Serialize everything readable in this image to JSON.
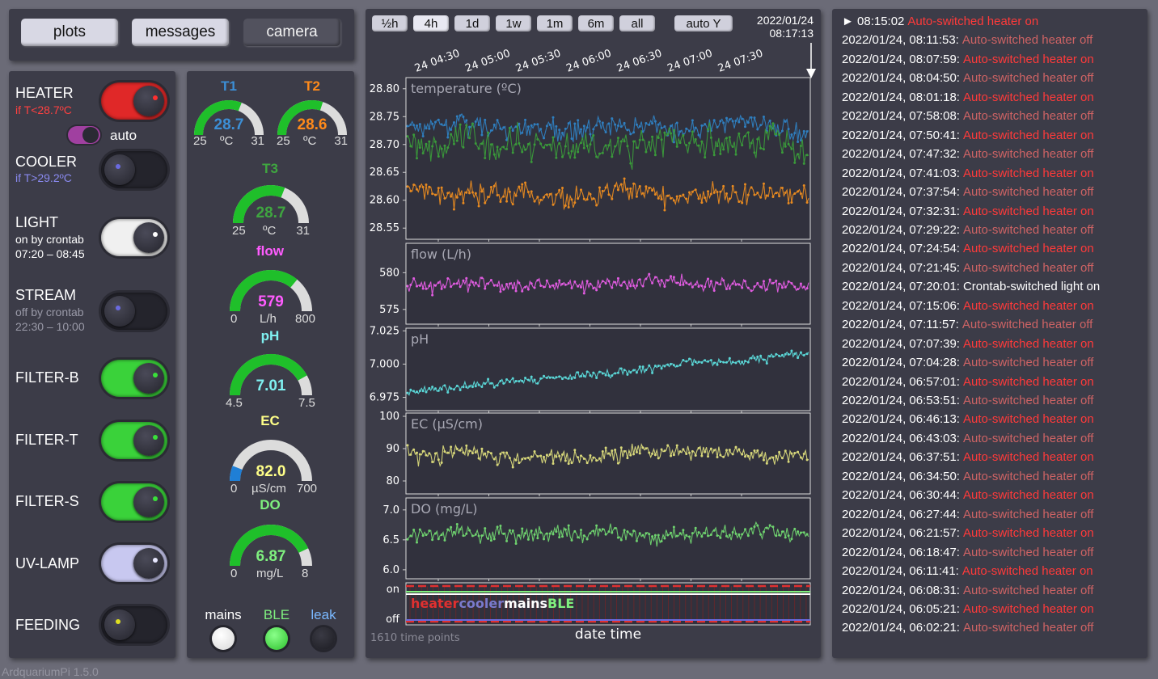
{
  "tabs": [
    {
      "label": "plots"
    },
    {
      "label": "messages"
    },
    {
      "label": "camera"
    }
  ],
  "controls": {
    "heater": {
      "label": "HEATER",
      "sub": "if T<28.7ºC",
      "auto_label": "auto"
    },
    "cooler": {
      "label": "COOLER",
      "sub": "if T>29.2ºC"
    },
    "light": {
      "label": "LIGHT",
      "sub1": "on by crontab",
      "sub2": "07:20 – 08:45"
    },
    "stream": {
      "label": "STREAM",
      "sub1": "off by crontab",
      "sub2": "22:30 – 10:00"
    },
    "filter_b": {
      "label": "FILTER-B"
    },
    "filter_t": {
      "label": "FILTER-T"
    },
    "filter_s": {
      "label": "FILTER-S"
    },
    "uv_lamp": {
      "label": "UV-LAMP"
    },
    "feeding": {
      "label": "FEEDING"
    }
  },
  "gauges": {
    "t1": {
      "title": "T1",
      "value": "28.7",
      "min": "25",
      "max": "31",
      "unit": "ºC",
      "fraction": 0.62,
      "color": "#3c8fd6"
    },
    "t2": {
      "title": "T2",
      "value": "28.6",
      "min": "25",
      "max": "31",
      "unit": "ºC",
      "fraction": 0.6,
      "color": "#ff8a1a"
    },
    "t3": {
      "title": "T3",
      "value": "28.7",
      "min": "25",
      "max": "31",
      "unit": "ºC",
      "fraction": 0.62,
      "color": "#3fa640"
    },
    "flow": {
      "title": "flow",
      "value": "579",
      "min": "0",
      "max": "800",
      "unit": "L/h",
      "fraction": 0.72,
      "color": "#ff5cff"
    },
    "ph": {
      "title": "pH",
      "value": "7.01",
      "min": "4.5",
      "max": "7.5",
      "unit": "",
      "fraction": 0.84,
      "color": "#7ff0f0"
    },
    "ec": {
      "title": "EC",
      "value": "82.0",
      "min": "0",
      "max": "700",
      "unit": "µS/cm",
      "fraction": 0.12,
      "color": "#ffff88"
    },
    "do": {
      "title": "DO",
      "value": "6.87",
      "min": "0",
      "max": "8",
      "unit": "mg/L",
      "fraction": 0.86,
      "color": "#7ff07f"
    }
  },
  "indicators": [
    {
      "label": "mains",
      "color": "#ffffff",
      "led": "#f4f4f4"
    },
    {
      "label": "BLE",
      "color": "#7ff07f",
      "led": "#3fe03f"
    },
    {
      "label": "leak",
      "color": "#7ab8ff",
      "led": "#26262e"
    }
  ],
  "range_buttons": [
    "½h",
    "4h",
    "1d",
    "1w",
    "1m",
    "6m",
    "all"
  ],
  "auto_y": "auto Y",
  "timestamp": {
    "date": "2022/01/24",
    "time": "08:17:13"
  },
  "chart_data": {
    "type": "line",
    "x_ticks": [
      "24 04:30",
      "24 05:00",
      "24 05:30",
      "24 06:00",
      "24 06:30",
      "24 07:00",
      "24 07:30"
    ],
    "xlabel": "date time",
    "points_note": "1610 time points",
    "panels": [
      {
        "title": "temperature (ºC)",
        "ylim": [
          28.53,
          28.82
        ],
        "ticks": [
          "28.80",
          "28.75",
          "28.70",
          "28.65",
          "28.60",
          "28.55"
        ],
        "series": [
          {
            "color": "#2f7fc0",
            "center": 28.73,
            "noise": 0.025
          },
          {
            "color": "#3a9a3a",
            "center": 28.7,
            "noise": 0.04
          },
          {
            "color": "#e88a20",
            "center": 28.61,
            "noise": 0.03
          }
        ]
      },
      {
        "title": "flow (L/h)",
        "ylim": [
          573,
          584
        ],
        "ticks": [
          "580",
          "575"
        ],
        "series": [
          {
            "color": "#e15ce1",
            "center": 578.5,
            "noise": 1.3
          }
        ]
      },
      {
        "title": "pH",
        "ylim": [
          6.965,
          7.027
        ],
        "ticks": [
          "7.025",
          "7.000",
          "6.975"
        ],
        "series": [
          {
            "color": "#5ad6d6",
            "center_start": 6.979,
            "center_end": 7.008,
            "noise": 0.004
          }
        ]
      },
      {
        "title": "EC (µS/cm)",
        "ylim": [
          76,
          101
        ],
        "ticks": [
          "100",
          "90",
          "80"
        ],
        "series": [
          {
            "color": "#d8d87a",
            "center": 88.5,
            "noise": 3.5
          }
        ]
      },
      {
        "title": "DO (mg/L)",
        "ylim": [
          5.85,
          7.2
        ],
        "ticks": [
          "7.0",
          "6.5",
          "6.0"
        ],
        "series": [
          {
            "color": "#6fd36f",
            "center": 6.6,
            "noise": 0.18
          }
        ]
      }
    ],
    "status_panel": {
      "ticks": [
        "on",
        "off"
      ],
      "labels": [
        {
          "text": "heater",
          "color": "#e03030"
        },
        {
          "text": "cooler",
          "color": "#7a7acc"
        },
        {
          "text": "mains",
          "color": "#ffffff"
        },
        {
          "text": "BLE",
          "color": "#7ff07f"
        }
      ]
    }
  },
  "log": [
    {
      "time": "► 08:15:02",
      "msg": "Auto-switched heater on",
      "kind": "on",
      "current": true
    },
    {
      "time": "2022/01/24, 08:11:53:",
      "msg": "Auto-switched heater off",
      "kind": "off"
    },
    {
      "time": "2022/01/24, 08:07:59:",
      "msg": "Auto-switched heater on",
      "kind": "on"
    },
    {
      "time": "2022/01/24, 08:04:50:",
      "msg": "Auto-switched heater off",
      "kind": "off"
    },
    {
      "time": "2022/01/24, 08:01:18:",
      "msg": "Auto-switched heater on",
      "kind": "on"
    },
    {
      "time": "2022/01/24, 07:58:08:",
      "msg": "Auto-switched heater off",
      "kind": "off"
    },
    {
      "time": "2022/01/24, 07:50:41:",
      "msg": "Auto-switched heater on",
      "kind": "on"
    },
    {
      "time": "2022/01/24, 07:47:32:",
      "msg": "Auto-switched heater off",
      "kind": "off"
    },
    {
      "time": "2022/01/24, 07:41:03:",
      "msg": "Auto-switched heater on",
      "kind": "on"
    },
    {
      "time": "2022/01/24, 07:37:54:",
      "msg": "Auto-switched heater off",
      "kind": "off"
    },
    {
      "time": "2022/01/24, 07:32:31:",
      "msg": "Auto-switched heater on",
      "kind": "on"
    },
    {
      "time": "2022/01/24, 07:29:22:",
      "msg": "Auto-switched heater off",
      "kind": "off"
    },
    {
      "time": "2022/01/24, 07:24:54:",
      "msg": "Auto-switched heater on",
      "kind": "on"
    },
    {
      "time": "2022/01/24, 07:21:45:",
      "msg": "Auto-switched heater off",
      "kind": "off"
    },
    {
      "time": "2022/01/24, 07:20:01:",
      "msg": "Crontab-switched light on",
      "kind": "cron"
    },
    {
      "time": "2022/01/24, 07:15:06:",
      "msg": "Auto-switched heater on",
      "kind": "on"
    },
    {
      "time": "2022/01/24, 07:11:57:",
      "msg": "Auto-switched heater off",
      "kind": "off"
    },
    {
      "time": "2022/01/24, 07:07:39:",
      "msg": "Auto-switched heater on",
      "kind": "on"
    },
    {
      "time": "2022/01/24, 07:04:28:",
      "msg": "Auto-switched heater off",
      "kind": "off"
    },
    {
      "time": "2022/01/24, 06:57:01:",
      "msg": "Auto-switched heater on",
      "kind": "on"
    },
    {
      "time": "2022/01/24, 06:53:51:",
      "msg": "Auto-switched heater off",
      "kind": "off"
    },
    {
      "time": "2022/01/24, 06:46:13:",
      "msg": "Auto-switched heater on",
      "kind": "on"
    },
    {
      "time": "2022/01/24, 06:43:03:",
      "msg": "Auto-switched heater off",
      "kind": "off"
    },
    {
      "time": "2022/01/24, 06:37:51:",
      "msg": "Auto-switched heater on",
      "kind": "on"
    },
    {
      "time": "2022/01/24, 06:34:50:",
      "msg": "Auto-switched heater off",
      "kind": "off"
    },
    {
      "time": "2022/01/24, 06:30:44:",
      "msg": "Auto-switched heater on",
      "kind": "on"
    },
    {
      "time": "2022/01/24, 06:27:44:",
      "msg": "Auto-switched heater off",
      "kind": "off"
    },
    {
      "time": "2022/01/24, 06:21:57:",
      "msg": "Auto-switched heater on",
      "kind": "on"
    },
    {
      "time": "2022/01/24, 06:18:47:",
      "msg": "Auto-switched heater off",
      "kind": "off"
    },
    {
      "time": "2022/01/24, 06:11:41:",
      "msg": "Auto-switched heater on",
      "kind": "on"
    },
    {
      "time": "2022/01/24, 06:08:31:",
      "msg": "Auto-switched heater off",
      "kind": "off"
    },
    {
      "time": "2022/01/24, 06:05:21:",
      "msg": "Auto-switched heater on",
      "kind": "on"
    },
    {
      "time": "2022/01/24, 06:02:21:",
      "msg": "Auto-switched heater off",
      "kind": "off"
    }
  ],
  "version": "ArdquariumPi 1.5.0"
}
